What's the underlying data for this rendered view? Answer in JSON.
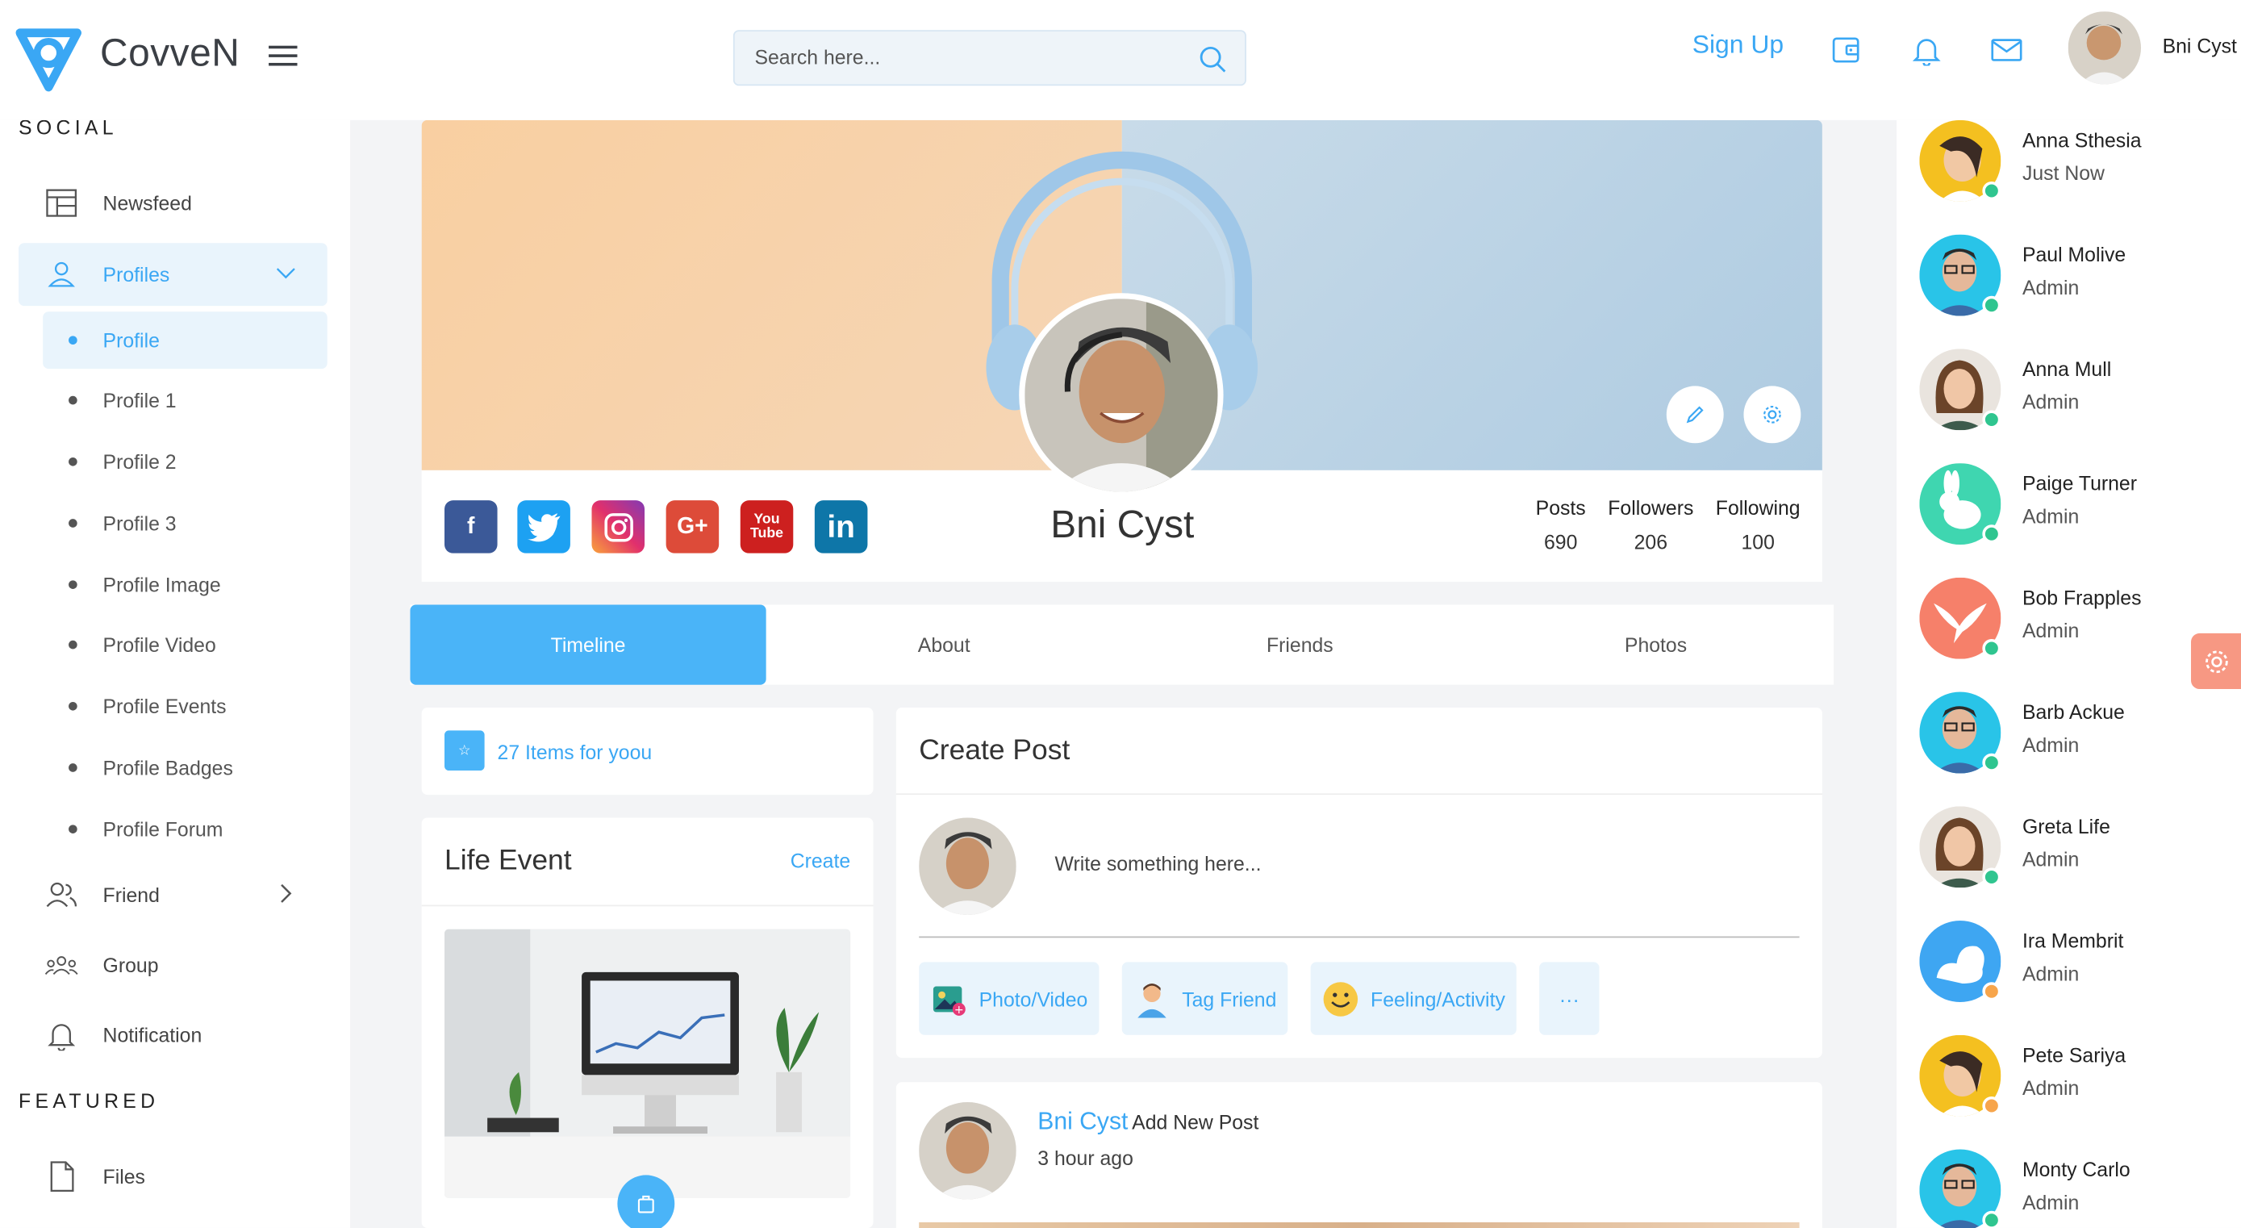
{
  "header": {
    "brand": "CovveN",
    "search_placeholder": "Search here...",
    "signup": "Sign Up",
    "user_name": "Bni Cyst"
  },
  "sidebar": {
    "social_title": "SOCIAL",
    "featured_title": "FEATURED",
    "items": {
      "newsfeed": "Newsfeed",
      "profiles": "Profiles",
      "friend": "Friend",
      "group": "Group",
      "notification": "Notification",
      "files": "Files"
    },
    "profile_sub": [
      "Profile",
      "Profile 1",
      "Profile 2",
      "Profile 3",
      "Profile Image",
      "Profile Video",
      "Profile Events",
      "Profile Badges",
      "Profile Forum"
    ]
  },
  "profile": {
    "name": "Bni Cyst",
    "stats": [
      {
        "label": "Posts",
        "value": "690"
      },
      {
        "label": "Followers",
        "value": "206"
      },
      {
        "label": "Following",
        "value": "100"
      }
    ]
  },
  "tabs": [
    "Timeline",
    "About",
    "Friends",
    "Photos"
  ],
  "items_card": {
    "text": "27 Items for yoou"
  },
  "life_event": {
    "title": "Life Event",
    "create": "Create"
  },
  "create_post": {
    "title": "Create Post",
    "placeholder": "Write something here...",
    "actions": [
      "Photo/Video",
      "Tag Friend",
      "Feeling/Activity",
      "···"
    ]
  },
  "feed": {
    "name": "Bni Cyst",
    "action": "Add New Post",
    "time": "3 hour ago"
  },
  "contacts": [
    {
      "name": "Anna Sthesia",
      "role": "Just Now",
      "status": "#2fc58f"
    },
    {
      "name": "Paul Molive",
      "role": "Admin",
      "status": "#2fc58f"
    },
    {
      "name": "Anna Mull",
      "role": "Admin",
      "status": "#2fc58f"
    },
    {
      "name": "Paige Turner",
      "role": "Admin",
      "status": "#2fc58f"
    },
    {
      "name": "Bob Frapples",
      "role": "Admin",
      "status": "#2fc58f"
    },
    {
      "name": "Barb Ackue",
      "role": "Admin",
      "status": "#2fc58f"
    },
    {
      "name": "Greta Life",
      "role": "Admin",
      "status": "#2fc58f"
    },
    {
      "name": "Ira Membrit",
      "role": "Admin",
      "status": "#f7a54b"
    },
    {
      "name": "Pete Sariya",
      "role": "Admin",
      "status": "#f7a54b"
    },
    {
      "name": "Monty Carlo",
      "role": "Admin",
      "status": "#2fc58f"
    }
  ],
  "colors": {
    "accent": "#3aa7f4",
    "tab_active": "#4ab4f8",
    "online": "#2fc58f",
    "away": "#f7a54b"
  }
}
